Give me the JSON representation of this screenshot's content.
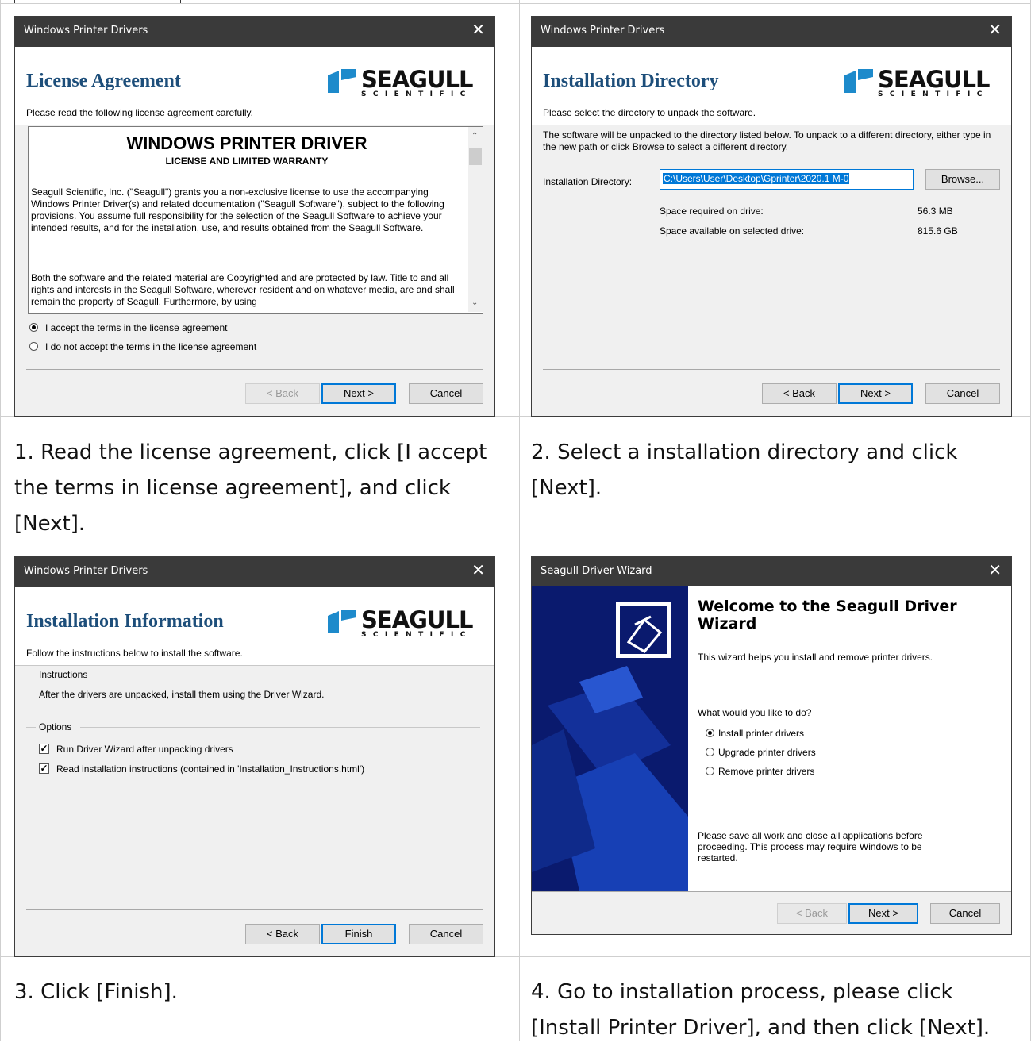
{
  "panel1": {
    "title": "Windows Printer Drivers",
    "close": "✕",
    "heading": "License Agreement",
    "subheading": "Please read the following license agreement carefully.",
    "logo": {
      "brand": "SEAGULL",
      "sub": "SCIENTIFIC"
    },
    "license": {
      "title": "WINDOWS PRINTER DRIVER",
      "subtitle": "LICENSE AND LIMITED WARRANTY",
      "para1": "Seagull Scientific, Inc. (\"Seagull\") grants you a non-exclusive license to use the accompanying Windows Printer Driver(s) and related documentation (\"Seagull Software\"), subject to the following provisions.  You assume full responsibility for the selection of the Seagull Software to achieve your intended results, and for the installation, use, and results obtained from the Seagull Software.",
      "para2": "Both the software and the related material are Copyrighted and are protected by law. Title to and all rights and interests in the Seagull Software, wherever resident and on whatever media, are and shall remain the property of Seagull.  Furthermore, by using"
    },
    "accept": "I accept the terms in the license agreement",
    "decline": "I do not accept the terms in the license agreement",
    "back": "< Back",
    "next": "Next >",
    "cancel": "Cancel"
  },
  "panel2": {
    "title": "Windows Printer Drivers",
    "close": "✕",
    "heading": "Installation Directory",
    "subheading": "Please select the directory to unpack the software.",
    "logo": {
      "brand": "SEAGULL",
      "sub": "SCIENTIFIC"
    },
    "desc": "The software will be unpacked to the directory listed below.  To unpack to a different directory, either type in the new path or click Browse to select a different directory.",
    "dir_label": "Installation Directory:",
    "dir_value": "C:\\Users\\User\\Desktop\\Gprinter\\2020.1 M-0",
    "browse": "Browse...",
    "space_required_label": "Space required on drive:",
    "space_required": "56.3 MB",
    "space_available_label": "Space available on selected drive:",
    "space_available": "815.6 GB",
    "back": "< Back",
    "next": "Next >",
    "cancel": "Cancel"
  },
  "panel3": {
    "title": "Windows Printer Drivers",
    "close": "✕",
    "heading": "Installation Information",
    "subheading": "Follow the instructions below to install the software.",
    "logo": {
      "brand": "SEAGULL",
      "sub": "SCIENTIFIC"
    },
    "instructions_group": "Instructions",
    "instructions_text": "After the drivers are unpacked, install them using the Driver Wizard.",
    "options_group": "Options",
    "option1": "Run Driver Wizard after unpacking drivers",
    "option2": "Read installation instructions (contained in 'Installation_Instructions.html')",
    "back": "< Back",
    "finish": "Finish",
    "cancel": "Cancel"
  },
  "panel4": {
    "title": "Seagull Driver Wizard",
    "close": "✕",
    "heading": "Welcome to the Seagull Driver Wizard",
    "intro": "This wizard helps you install and remove printer drivers.",
    "question": "What would you like to do?",
    "options": [
      "Install printer drivers",
      "Upgrade printer drivers",
      "Remove printer drivers"
    ],
    "note": "Please save all work and close all applications before proceeding.  This process may require Windows to be restarted.",
    "back": "< Back",
    "next": "Next >",
    "cancel": "Cancel"
  },
  "captions": {
    "c1": "1. Read the license agreement, click [I accept the terms in license agreement], and click [Next].",
    "c2": "2. Select a installation directory and click [Next].",
    "c3": "3. Click [Finish].",
    "c4": "4. Go to installation process, please click [Install Printer Driver], and then click [Next]."
  },
  "colors": {
    "titlebar": "#3a3a3a",
    "heading": "#1d4e7a",
    "accent": "#0078d7",
    "wizard_side": "#0a1a6e"
  }
}
